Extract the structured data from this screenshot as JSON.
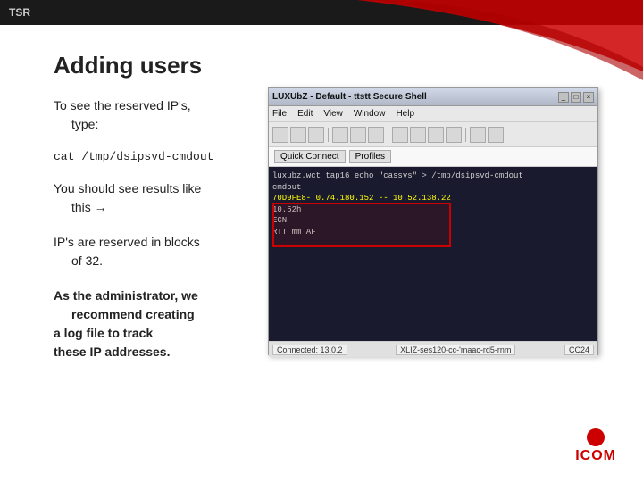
{
  "topbar": {
    "label": "TSR"
  },
  "title": "Adding users",
  "sections": [
    {
      "id": "reserved-ips",
      "text": "To see the reserved IP's, type:"
    },
    {
      "id": "command",
      "text": "cat /tmp/dsipsvd-cmdout"
    },
    {
      "id": "results",
      "text": "You should see results like this →"
    },
    {
      "id": "ip-blocks",
      "text": "IP's are reserved in blocks of 32."
    },
    {
      "id": "admin-note",
      "text": "As the administrator, we recommend creating a log file to track these IP addresses."
    }
  ],
  "terminal": {
    "title": "LUXUbZ - Default - ttstt Secure Shell",
    "menu": [
      "File",
      "Edit",
      "View",
      "Window",
      "Help"
    ],
    "address_buttons": [
      "Quick Connect",
      "Profiles"
    ],
    "lines": [
      "luxubz.wct tap16 echo \"cassvs\" > /tmp/dsipsvd-cmdout",
      "cmdout",
      "70D9FE8- 0.74.180.152 -- 10.52.138.22",
      "10.52h",
      "ECN",
      "RTT mm AF"
    ],
    "statusbar": {
      "connected": "Connected: 13.0.2",
      "session": "XLIZ-ses120-cc-'maac-rd5-rnm",
      "codec": "CC24"
    }
  },
  "logo": {
    "text": "ICOM"
  }
}
